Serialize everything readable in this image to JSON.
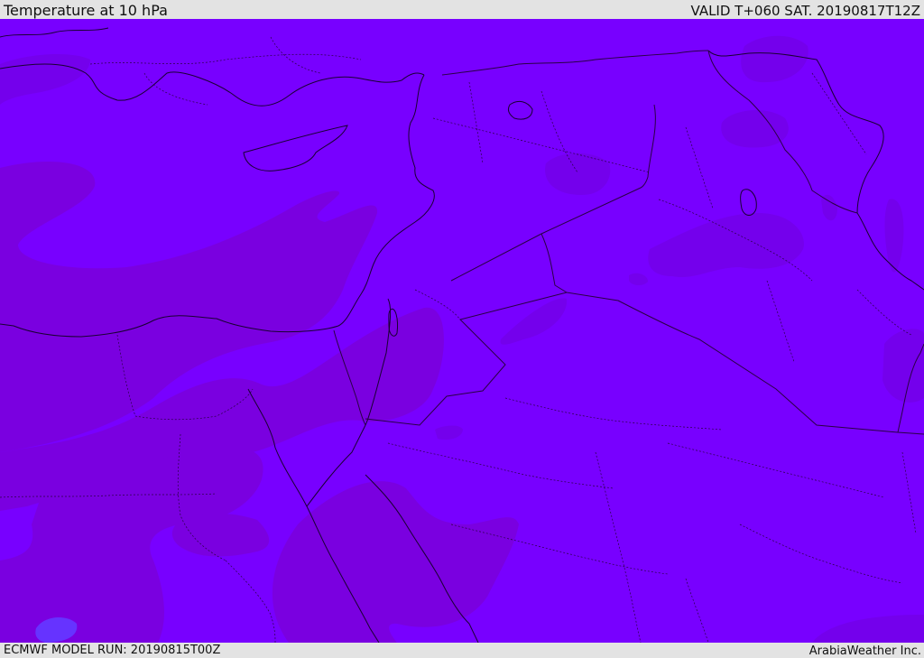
{
  "header": {
    "title": "Temperature at 10 hPa",
    "valid": "VALID T+060 SAT. 20190817T12Z"
  },
  "footer": {
    "model_run": "ECMWF MODEL RUN: 20190815T00Z",
    "credit": "ArabiaWeather Inc."
  },
  "map": {
    "colors": {
      "background": "#7800ff",
      "band_dark": "#7a00e0",
      "band_mid": "#7400ec",
      "spot_light": "#6633ff",
      "coastline": "#1a0033",
      "border": "#2a0044"
    }
  }
}
